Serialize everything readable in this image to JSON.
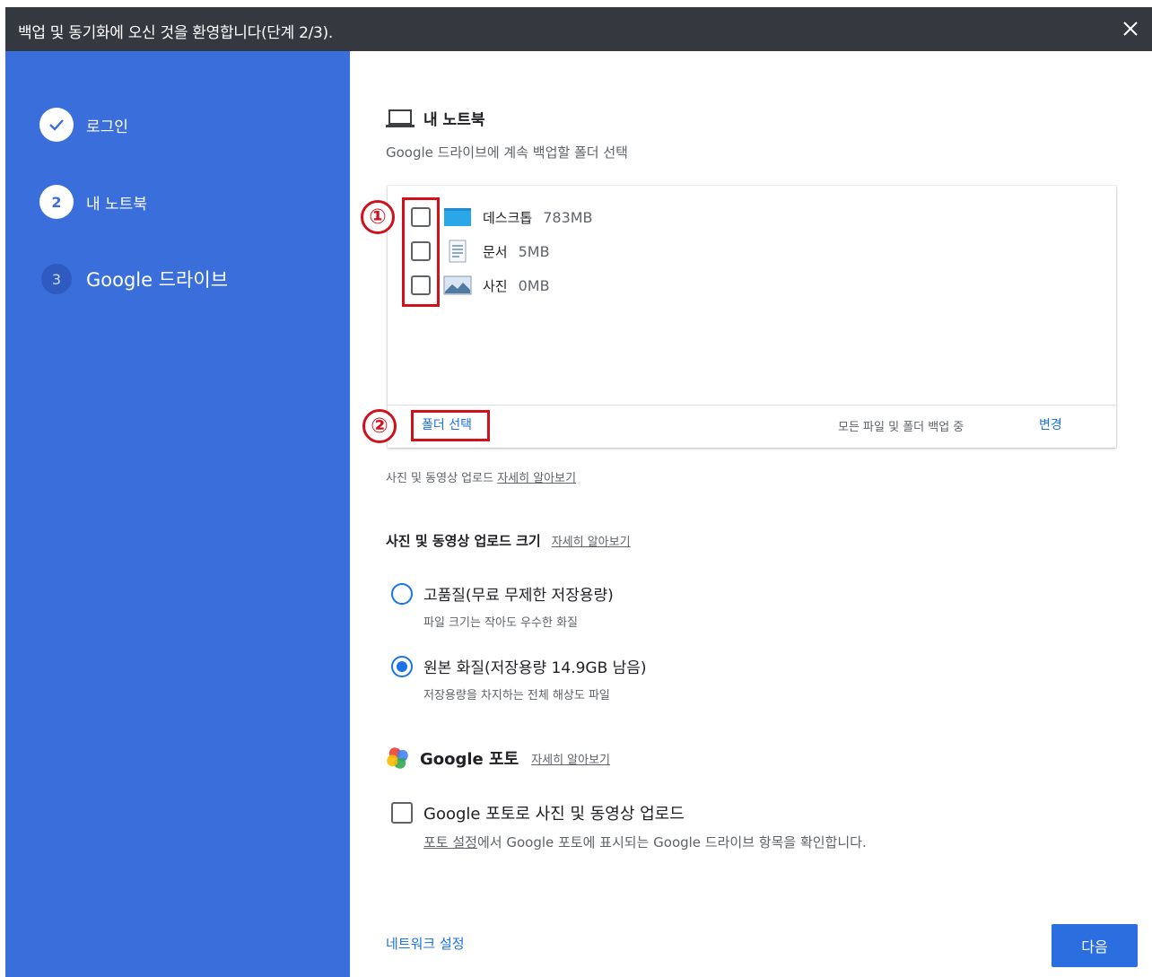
{
  "window": {
    "title": "백업 및 동기화에 오신 것을 환영합니다(단계 2/3).",
    "close_icon": "close-icon"
  },
  "sidebar": {
    "steps": [
      {
        "number": "",
        "label": "로그인",
        "state": "done",
        "icon": "check-icon"
      },
      {
        "number": "2",
        "label": "내 노트북",
        "state": "current"
      },
      {
        "number": "3",
        "label": "Google 드라이브",
        "state": "future"
      }
    ]
  },
  "main": {
    "section_icon": "laptop-icon",
    "section_title": "내 노트북",
    "section_subtitle": "Google 드라이브에 계속 백업할 폴더 선택",
    "folders": [
      {
        "name": "데스크톱",
        "size": "783MB",
        "icon": "desktop-folder-icon",
        "checked": false
      },
      {
        "name": "문서",
        "size": "5MB",
        "icon": "document-folder-icon",
        "checked": false
      },
      {
        "name": "사진",
        "size": "0MB",
        "icon": "pictures-folder-icon",
        "checked": false
      }
    ],
    "choose_folder": "폴더 선택",
    "backup_status": "모든 파일 및 폴더 백업 중",
    "change": "변경",
    "annotations": {
      "one": "①",
      "two": "②"
    },
    "photo_note": "사진 및 동영상 업로드",
    "learn_more": "자세히 알아보기",
    "upload_size": {
      "title": "사진 및 동영상 업로드 크기",
      "learn_more": "자세히 알아보기",
      "options": [
        {
          "label": "고품질(무료 무제한 저장용량)",
          "description": "파일 크기는 작아도 우수한 화질",
          "selected": false
        },
        {
          "label": "원본 화질(저장용량 14.9GB 남음)",
          "description": "저장용량을 차지하는 전체 해상도 파일",
          "selected": true
        }
      ]
    },
    "google_photos": {
      "icon": "google-photos-icon",
      "title": "Google 포토",
      "learn_more": "자세히 알아보기",
      "checkbox_label": "Google 포토로 사진 및 동영상 업로드",
      "checked": false,
      "note_link": "포토 설정",
      "note_rest": "에서 Google 포토에 표시되는 Google 드라이브 항목을 확인합니다."
    },
    "network_settings": "네트워크 설정",
    "next_button": "다음"
  },
  "colors": {
    "sidebar": "#3a6fdb",
    "titlebar": "#33393f",
    "accent": "#1a73e8",
    "annotation": "#d0101b"
  }
}
